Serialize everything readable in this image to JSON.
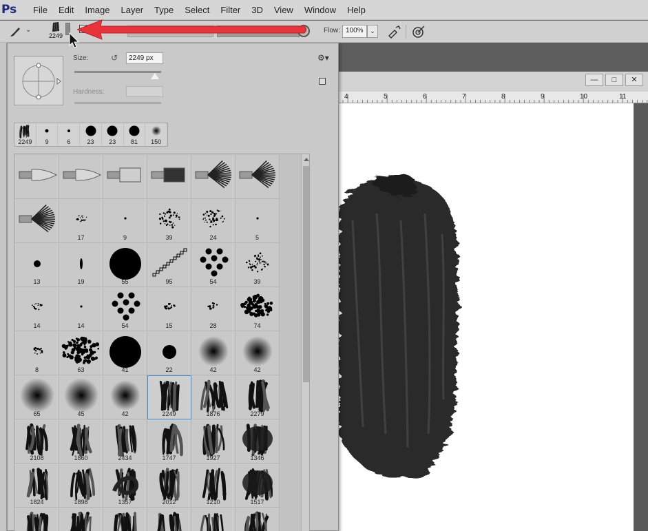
{
  "app": {
    "logo": "Ps"
  },
  "menu": [
    "File",
    "Edit",
    "Image",
    "Layer",
    "Type",
    "Select",
    "Filter",
    "3D",
    "View",
    "Window",
    "Help"
  ],
  "options_bar": {
    "brush_size_readout": "2249",
    "flow_label": "Flow:",
    "flow_value": "100%",
    "annotation_color": "#e8333b"
  },
  "brush_picker": {
    "size_label": "Size:",
    "size_value": "2249 px",
    "size_slider_fraction": 0.93,
    "hardness_label": "Hardness:",
    "recent_brushes": [
      {
        "size": "2249",
        "kind": "stroke"
      },
      {
        "size": "9",
        "kind": "round",
        "d": 5
      },
      {
        "size": "6",
        "kind": "round",
        "d": 4
      },
      {
        "size": "23",
        "kind": "round",
        "d": 15
      },
      {
        "size": "23",
        "kind": "round",
        "d": 15
      },
      {
        "size": "81",
        "kind": "round",
        "d": 15
      },
      {
        "size": "150",
        "kind": "soft",
        "d": 14
      }
    ],
    "brushes": [
      {
        "num": "",
        "kind": "bristle-round"
      },
      {
        "num": "",
        "kind": "bristle-round"
      },
      {
        "num": "",
        "kind": "bristle-flat"
      },
      {
        "num": "",
        "kind": "bristle-flat-dark"
      },
      {
        "num": "",
        "kind": "bristle-fan"
      },
      {
        "num": "",
        "kind": "bristle-fan"
      },
      {
        "num": "",
        "kind": "bristle-fan"
      },
      {
        "num": "17",
        "kind": "scatter-small"
      },
      {
        "num": "9",
        "kind": "dot-tiny"
      },
      {
        "num": "39",
        "kind": "scatter"
      },
      {
        "num": "24",
        "kind": "scatter"
      },
      {
        "num": "5",
        "kind": "dot-tiny"
      },
      {
        "num": "13",
        "kind": "dot-small"
      },
      {
        "num": "19",
        "kind": "ellipse-thin"
      },
      {
        "num": "55",
        "kind": "dot-large"
      },
      {
        "num": "95",
        "kind": "chain"
      },
      {
        "num": "54",
        "kind": "spots"
      },
      {
        "num": "39",
        "kind": "scatter"
      },
      {
        "num": "14",
        "kind": "scatter-small"
      },
      {
        "num": "14",
        "kind": "dot-tiny"
      },
      {
        "num": "54",
        "kind": "spots"
      },
      {
        "num": "15",
        "kind": "scatter-small"
      },
      {
        "num": "28",
        "kind": "scatter-small"
      },
      {
        "num": "74",
        "kind": "blob"
      },
      {
        "num": "8",
        "kind": "scatter-small"
      },
      {
        "num": "63",
        "kind": "blob-wide"
      },
      {
        "num": "41",
        "kind": "dot-large"
      },
      {
        "num": "22",
        "kind": "dot-medium"
      },
      {
        "num": "42",
        "kind": "soft"
      },
      {
        "num": "42",
        "kind": "soft"
      },
      {
        "num": "65",
        "kind": "soft-large"
      },
      {
        "num": "45",
        "kind": "soft-large"
      },
      {
        "num": "42",
        "kind": "soft"
      },
      {
        "num": "2249",
        "kind": "stroke",
        "selected": true
      },
      {
        "num": "1876",
        "kind": "stroke"
      },
      {
        "num": "2279",
        "kind": "stroke"
      },
      {
        "num": "2108",
        "kind": "stroke"
      },
      {
        "num": "1860",
        "kind": "stroke"
      },
      {
        "num": "2434",
        "kind": "stroke"
      },
      {
        "num": "1747",
        "kind": "stroke"
      },
      {
        "num": "1927",
        "kind": "stroke"
      },
      {
        "num": "1346",
        "kind": "stroke-blob"
      },
      {
        "num": "1824",
        "kind": "stroke"
      },
      {
        "num": "1898",
        "kind": "stroke"
      },
      {
        "num": "1357",
        "kind": "stroke-swirl"
      },
      {
        "num": "2012",
        "kind": "stroke"
      },
      {
        "num": "1210",
        "kind": "stroke"
      },
      {
        "num": "1517",
        "kind": "stroke-blob"
      },
      {
        "num": "",
        "kind": "stroke"
      },
      {
        "num": "",
        "kind": "stroke"
      },
      {
        "num": "",
        "kind": "stroke"
      },
      {
        "num": "",
        "kind": "stroke"
      },
      {
        "num": "",
        "kind": "stroke"
      },
      {
        "num": "",
        "kind": "stroke"
      }
    ]
  },
  "document": {
    "ruler_ticks": [
      "4",
      "5",
      "6",
      "7",
      "8",
      "9",
      "10",
      "11"
    ]
  }
}
